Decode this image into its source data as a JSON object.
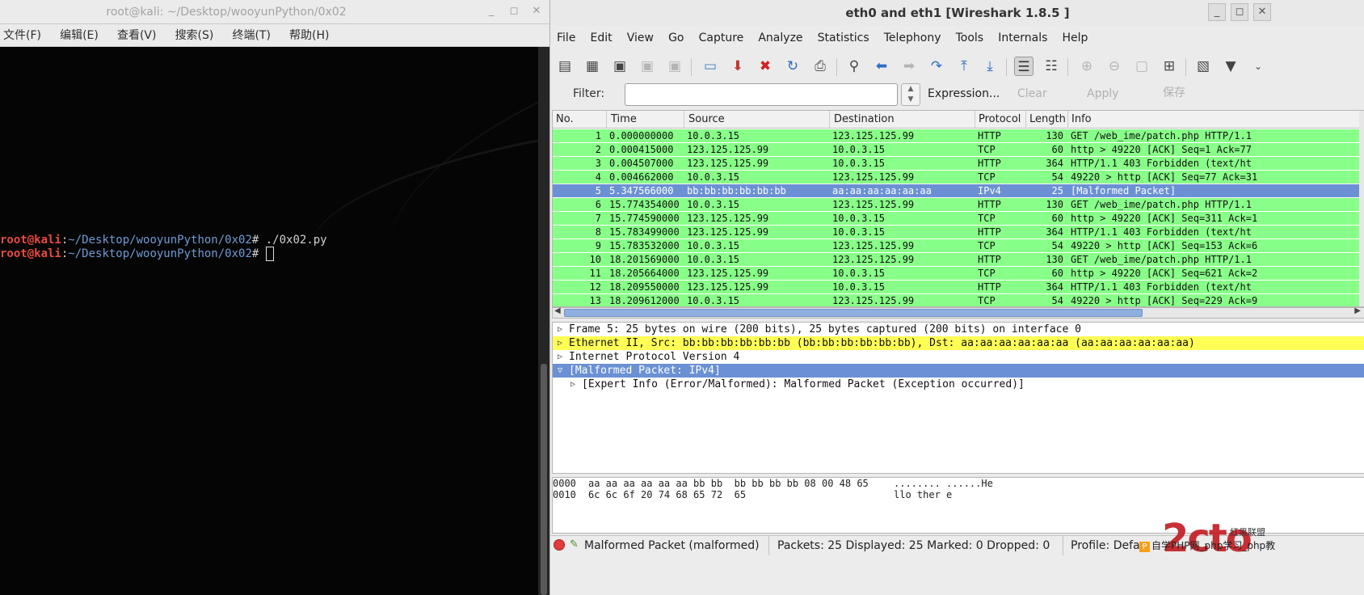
{
  "terminal": {
    "title": "root@kali: ~/Desktop/wooyunPython/0x02",
    "menu": [
      "文件(F)",
      "编辑(E)",
      "查看(V)",
      "搜索(S)",
      "终端(T)",
      "帮助(H)"
    ],
    "prompt_user": "root@kali",
    "prompt_path": "~/Desktop/wooyunPython/0x02",
    "prompt_sign": "# ",
    "command1": "./0x02.py",
    "colors": {
      "user": "#e84a3c",
      "path": "#6f9bd6",
      "background": "#050505"
    }
  },
  "wireshark": {
    "title": "eth0 and eth1   [Wireshark 1.8.5 ]",
    "menu": [
      "File",
      "Edit",
      "View",
      "Go",
      "Capture",
      "Analyze",
      "Statistics",
      "Telephony",
      "Tools",
      "Internals",
      "Help"
    ],
    "toolbar_icons": [
      "interfaces-icon",
      "capture-options-icon",
      "start-capture-icon",
      "stop-capture-icon",
      "restart-capture-icon",
      "open-file-icon",
      "save-file-icon",
      "close-file-icon",
      "reload-icon",
      "print-icon",
      "find-packet-icon",
      "go-back-icon",
      "go-forward-icon",
      "go-to-packet-icon",
      "first-packet-icon",
      "last-packet-icon",
      "colorize-icon",
      "auto-scroll-icon",
      "zoom-in-icon",
      "zoom-out-icon",
      "normal-size-icon",
      "resize-columns-icon",
      "capture-filters-icon",
      "display-filters-icon",
      "more-icon"
    ],
    "filter": {
      "label": "Filter:",
      "value": "",
      "expression": "Expression...",
      "clear": "Clear",
      "apply": "Apply",
      "save": "保存"
    },
    "columns": [
      "No.",
      "Time",
      "Source",
      "Destination",
      "Protocol",
      "Length",
      "Info"
    ],
    "packets": [
      {
        "no": "1",
        "time": "0.000000000",
        "src": "10.0.3.15",
        "dst": "123.125.125.99",
        "proto": "HTTP",
        "len": "130",
        "info": "GET /web_ime/patch.php HTTP/1.1"
      },
      {
        "no": "2",
        "time": "0.000415000",
        "src": "123.125.125.99",
        "dst": "10.0.3.15",
        "proto": "TCP",
        "len": "60",
        "info": "http > 49220 [ACK] Seq=1 Ack=77"
      },
      {
        "no": "3",
        "time": "0.004507000",
        "src": "123.125.125.99",
        "dst": "10.0.3.15",
        "proto": "HTTP",
        "len": "364",
        "info": "HTTP/1.1 403 Forbidden  (text/ht"
      },
      {
        "no": "4",
        "time": "0.004662000",
        "src": "10.0.3.15",
        "dst": "123.125.125.99",
        "proto": "TCP",
        "len": "54",
        "info": "49220 > http [ACK] Seq=77 Ack=31"
      },
      {
        "no": "5",
        "time": "5.347566000",
        "src": "bb:bb:bb:bb:bb:bb",
        "dst": "aa:aa:aa:aa:aa:aa",
        "proto": "IPv4",
        "len": "25",
        "info": "[Malformed Packet]",
        "selected": true
      },
      {
        "no": "6",
        "time": "15.774354000",
        "src": "10.0.3.15",
        "dst": "123.125.125.99",
        "proto": "HTTP",
        "len": "130",
        "info": "GET /web_ime/patch.php HTTP/1.1"
      },
      {
        "no": "7",
        "time": "15.774590000",
        "src": "123.125.125.99",
        "dst": "10.0.3.15",
        "proto": "TCP",
        "len": "60",
        "info": "http > 49220 [ACK] Seq=311 Ack=1"
      },
      {
        "no": "8",
        "time": "15.783499000",
        "src": "123.125.125.99",
        "dst": "10.0.3.15",
        "proto": "HTTP",
        "len": "364",
        "info": "HTTP/1.1 403 Forbidden  (text/ht"
      },
      {
        "no": "9",
        "time": "15.783532000",
        "src": "10.0.3.15",
        "dst": "123.125.125.99",
        "proto": "TCP",
        "len": "54",
        "info": "49220 > http [ACK] Seq=153 Ack=6"
      },
      {
        "no": "10",
        "time": "18.201569000",
        "src": "10.0.3.15",
        "dst": "123.125.125.99",
        "proto": "HTTP",
        "len": "130",
        "info": "GET /web_ime/patch.php HTTP/1.1"
      },
      {
        "no": "11",
        "time": "18.205664000",
        "src": "123.125.125.99",
        "dst": "10.0.3.15",
        "proto": "TCP",
        "len": "60",
        "info": "http > 49220 [ACK] Seq=621 Ack=2"
      },
      {
        "no": "12",
        "time": "18.209550000",
        "src": "123.125.125.99",
        "dst": "10.0.3.15",
        "proto": "HTTP",
        "len": "364",
        "info": "HTTP/1.1 403 Forbidden  (text/ht"
      },
      {
        "no": "13",
        "time": "18.209612000",
        "src": "10.0.3.15",
        "dst": "123.125.125.99",
        "proto": "TCP",
        "len": "54",
        "info": "49220 > http [ACK] Seq=229 Ack=9"
      }
    ],
    "details": [
      {
        "text": "Frame 5: 25 bytes on wire (200 bits), 25 bytes captured (200 bits) on interface 0",
        "state": "collapsed",
        "style": "plain"
      },
      {
        "text": "Ethernet II, Src: bb:bb:bb:bb:bb:bb (bb:bb:bb:bb:bb:bb), Dst: aa:aa:aa:aa:aa:aa (aa:aa:aa:aa:aa:aa)",
        "state": "collapsed",
        "style": "yellow"
      },
      {
        "text": "Internet Protocol Version 4",
        "state": "collapsed",
        "style": "plain"
      },
      {
        "text": "[Malformed Packet: IPv4]",
        "state": "expanded",
        "style": "selected"
      },
      {
        "text": "[Expert Info (Error/Malformed): Malformed Packet (Exception occurred)]",
        "state": "collapsed",
        "style": "child"
      }
    ],
    "bytes": [
      {
        "offset": "0000",
        "hex": "aa aa aa aa aa aa bb bb  bb bb bb bb 08 00 48 65",
        "ascii": "........ ......He"
      },
      {
        "offset": "0010",
        "hex": "6c 6c 6f 20 74 68 65 72  65",
        "ascii": "llo ther e"
      }
    ],
    "status": {
      "expert": "Malformed Packet (malformed)",
      "packets": "Packets: 25 Displayed: 25 Marked: 0 Dropped: 0",
      "profile": "Profile: Defau"
    },
    "colors": {
      "packet_row": "#88ff88",
      "selected_row": "#6b91d4",
      "highlight_yellow": "#ffff55"
    }
  },
  "watermark": {
    "logo": "2cto",
    "stamp": "红黑联盟",
    "text": "自学PHP网_php学习_php教"
  }
}
